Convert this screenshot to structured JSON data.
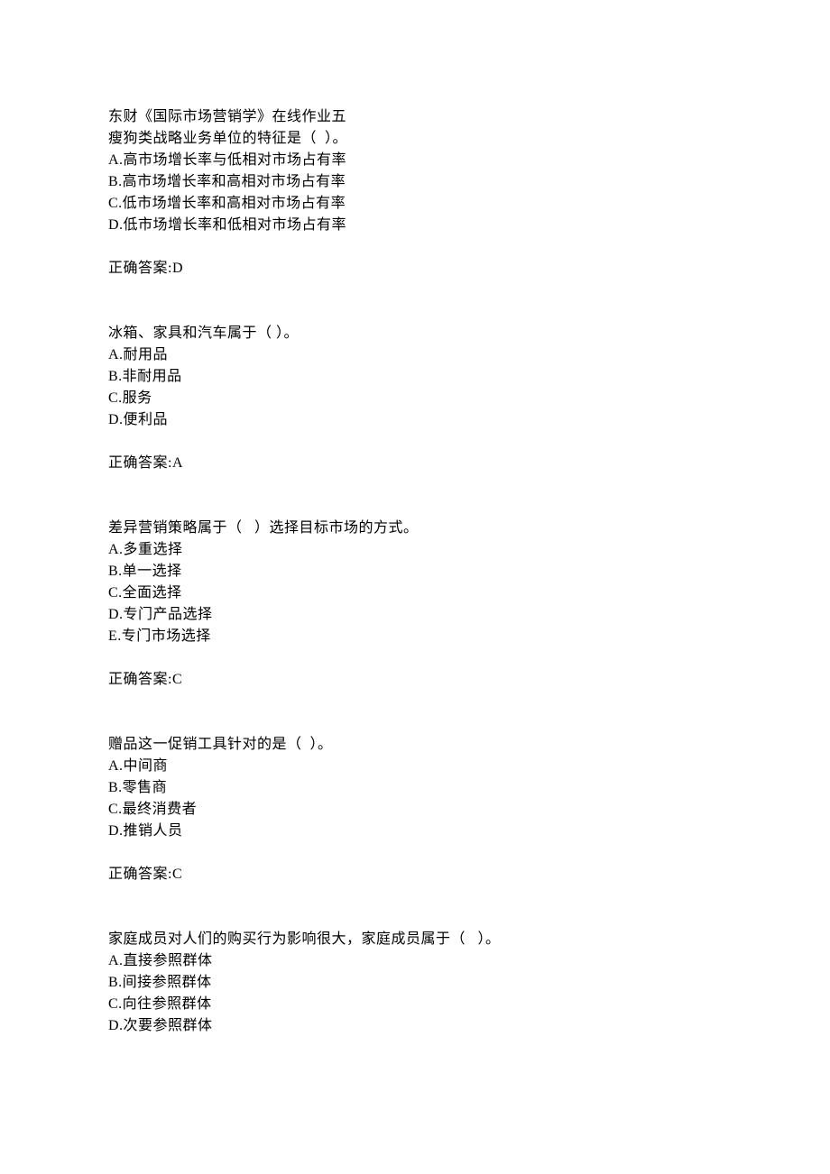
{
  "title": "东财《国际市场营销学》在线作业五",
  "questions": [
    {
      "stem": "瘦狗类战略业务单位的特征是（  ）。",
      "options": [
        "A.高市场增长率与低相对市场占有率",
        "B.高市场增长率和高相对市场占有率",
        "C.低市场增长率和高相对市场占有率",
        "D.低市场增长率和低相对市场占有率"
      ],
      "answer": "正确答案:D"
    },
    {
      "stem": "冰箱、家具和汽车属于（ ）。",
      "options": [
        "A.耐用品",
        "B.非耐用品",
        "C.服务",
        "D.便利品"
      ],
      "answer": "正确答案:A"
    },
    {
      "stem": "差异营销策略属于（   ）选择目标市场的方式。",
      "options": [
        "A.多重选择",
        "B.单一选择",
        "C.全面选择",
        "D.专门产品选择",
        "E.专门市场选择"
      ],
      "answer": "正确答案:C"
    },
    {
      "stem": "赠品这一促销工具针对的是（  ）。",
      "options": [
        "A.中间商",
        "B.零售商",
        "C.最终消费者",
        "D.推销人员"
      ],
      "answer": "正确答案:C"
    },
    {
      "stem": "家庭成员对人们的购买行为影响很大，家庭成员属于（   ）。",
      "options": [
        "A.直接参照群体",
        "B.间接参照群体",
        "C.向往参照群体",
        "D.次要参照群体"
      ],
      "answer": ""
    }
  ]
}
